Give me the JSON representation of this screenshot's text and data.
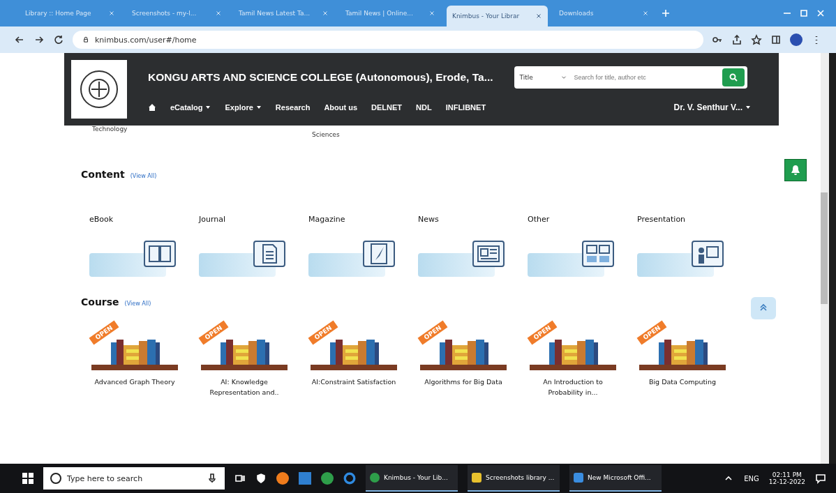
{
  "browser": {
    "tabs": [
      {
        "title": "Library :: Home Page",
        "selected": false
      },
      {
        "title": "Screenshots - my-l...",
        "selected": false
      },
      {
        "title": "Tamil News Latest Ta...",
        "selected": false
      },
      {
        "title": "Tamil News | Online...",
        "selected": false
      },
      {
        "title": "Knimbus - Your Librar",
        "selected": true
      },
      {
        "title": "Downloads",
        "selected": false
      }
    ],
    "url": "knimbus.com/user#/home"
  },
  "header": {
    "college": "KONGU ARTS AND SCIENCE COLLEGE (Autonomous), Erode, Ta...",
    "search": {
      "field": "Title",
      "placeholder": "Search for title, author etc"
    },
    "nav": [
      {
        "label": "eCatalog",
        "dropdown": true
      },
      {
        "label": "Explore",
        "dropdown": true
      },
      {
        "label": "Research",
        "dropdown": false
      },
      {
        "label": "About us",
        "dropdown": false
      },
      {
        "label": "DELNET",
        "dropdown": false
      },
      {
        "label": "NDL",
        "dropdown": false
      },
      {
        "label": "INFLIBNET",
        "dropdown": false
      }
    ],
    "user": "Dr. V. Senthur V..."
  },
  "cut_labels": [
    "Technology",
    "Sciences"
  ],
  "content": {
    "title": "Content",
    "view_all": "(View All)",
    "items": [
      {
        "label": "eBook",
        "kind": "book"
      },
      {
        "label": "Journal",
        "kind": "document"
      },
      {
        "label": "Magazine",
        "kind": "magazine"
      },
      {
        "label": "News",
        "kind": "newspaper"
      },
      {
        "label": "Other",
        "kind": "other"
      },
      {
        "label": "Presentation",
        "kind": "presentation"
      }
    ]
  },
  "course": {
    "title": "Course",
    "view_all": "(View All)",
    "items": [
      {
        "badge": "OPEN",
        "title": "Advanced Graph Theory"
      },
      {
        "badge": "OPEN",
        "title": "AI: Knowledge Representation and.."
      },
      {
        "badge": "OPEN",
        "title": "AI:Constraint Satisfaction"
      },
      {
        "badge": "OPEN",
        "title": "Algorithms for Big Data"
      },
      {
        "badge": "OPEN",
        "title": "An Introduction to Probability in..."
      },
      {
        "badge": "OPEN",
        "title": "Big Data Computing"
      }
    ]
  },
  "taskbar": {
    "search_placeholder": "Type here to search",
    "apps": [
      {
        "label": "Knimbus - Your Lib...",
        "kind": "chrome"
      },
      {
        "label": "Screenshots library ...",
        "kind": "folder"
      },
      {
        "label": "New Microsoft Offi...",
        "kind": "office"
      }
    ],
    "language": "ENG",
    "time": "02:11 PM",
    "date": "12-12-2022"
  }
}
